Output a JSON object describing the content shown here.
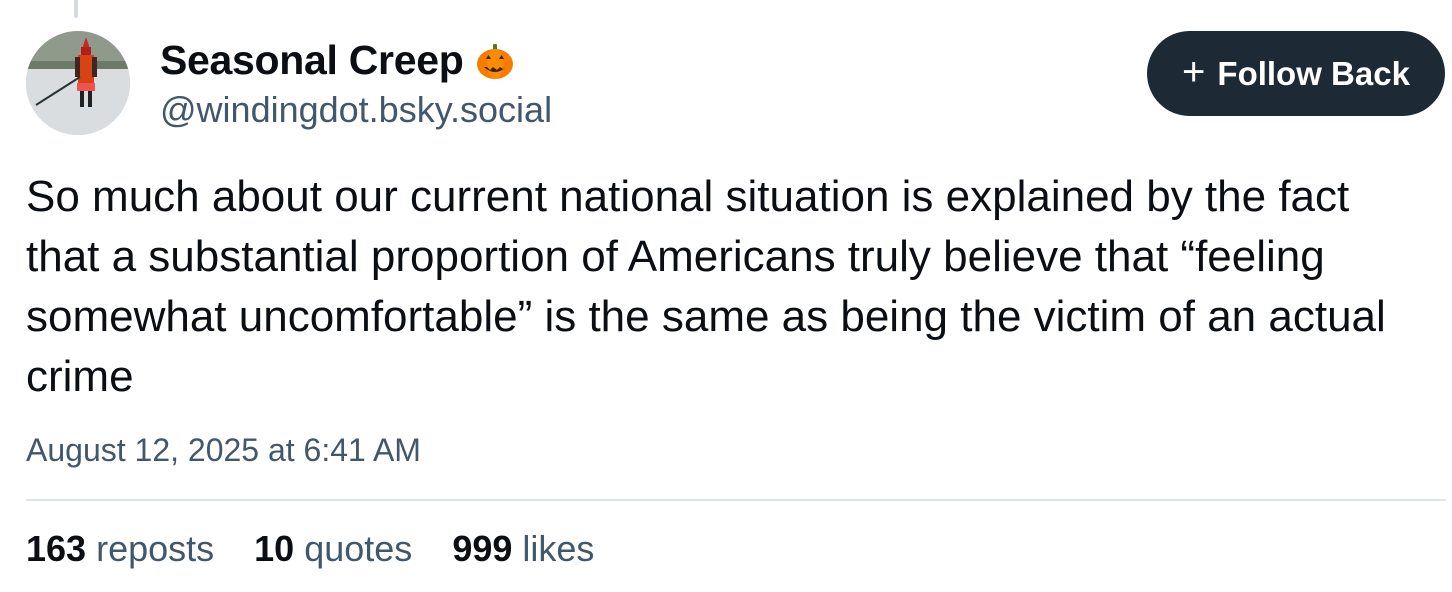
{
  "post": {
    "author": {
      "display_name": "Seasonal Creep",
      "handle": "@windingdot.bsky.social",
      "badge_icon": "pumpkin-emoji",
      "avatar_icon": "hockey-player-avatar"
    },
    "follow_button": {
      "icon": "plus-icon",
      "label": "Follow Back"
    },
    "text": "So much about our current national situation is explained by the fact that a substantial proportion of Americans truly believe that “feeling somewhat uncomfortable” is the same as being the victim of an actual crime",
    "timestamp": "August 12, 2025 at 6:41 AM",
    "stats": {
      "reposts": {
        "count": "163",
        "label": "reposts"
      },
      "quotes": {
        "count": "10",
        "label": "quotes"
      },
      "likes": {
        "count": "999",
        "label": "likes"
      }
    }
  },
  "colors": {
    "button_bg": "#1e2936",
    "muted_text": "#42576c",
    "primary_text": "#0b0f14",
    "divider": "#dfe4ea"
  }
}
